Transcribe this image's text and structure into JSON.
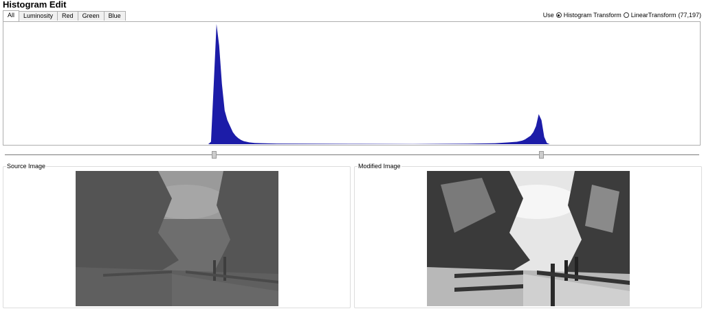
{
  "window": {
    "title": "Histogram Edit"
  },
  "tabs": [
    {
      "label": "All",
      "active": true
    },
    {
      "label": "Luminosity",
      "active": false
    },
    {
      "label": "Red",
      "active": false
    },
    {
      "label": "Green",
      "active": false
    },
    {
      "label": "Blue",
      "active": false
    }
  ],
  "options": {
    "use_label": "Use",
    "histogram_transform_label": "Histogram Transform",
    "linear_transform_label": "LinearTransform",
    "range_text": "(77,197)",
    "selected": "Histogram Transform"
  },
  "slider": {
    "low": 77,
    "high": 197,
    "min": 0,
    "max": 255
  },
  "chart_data": {
    "type": "area",
    "fill_color": "#1c1ca8",
    "grid": false,
    "xlim": [
      0,
      255
    ],
    "x": [
      75,
      76,
      77,
      78,
      79,
      80,
      81,
      82,
      83,
      84,
      85,
      86,
      87,
      88,
      90,
      92,
      95,
      100,
      110,
      130,
      150,
      170,
      180,
      185,
      187,
      188,
      189,
      190,
      191,
      192,
      193,
      194,
      195,
      196,
      197,
      198,
      199,
      200
    ],
    "values": [
      0,
      0.02,
      0.5,
      1.0,
      0.82,
      0.5,
      0.28,
      0.2,
      0.15,
      0.1,
      0.07,
      0.05,
      0.035,
      0.025,
      0.015,
      0.01,
      0.008,
      0.005,
      0.004,
      0.003,
      0.002,
      0.004,
      0.008,
      0.015,
      0.018,
      0.02,
      0.025,
      0.03,
      0.04,
      0.055,
      0.07,
      0.1,
      0.15,
      0.25,
      0.2,
      0.06,
      0.01,
      0
    ]
  },
  "source_panel": {
    "label": "Source Image"
  },
  "modified_panel": {
    "label": "Modified Image"
  },
  "colors": {
    "histogram": "#1c1ca8",
    "border": "#adadad"
  }
}
